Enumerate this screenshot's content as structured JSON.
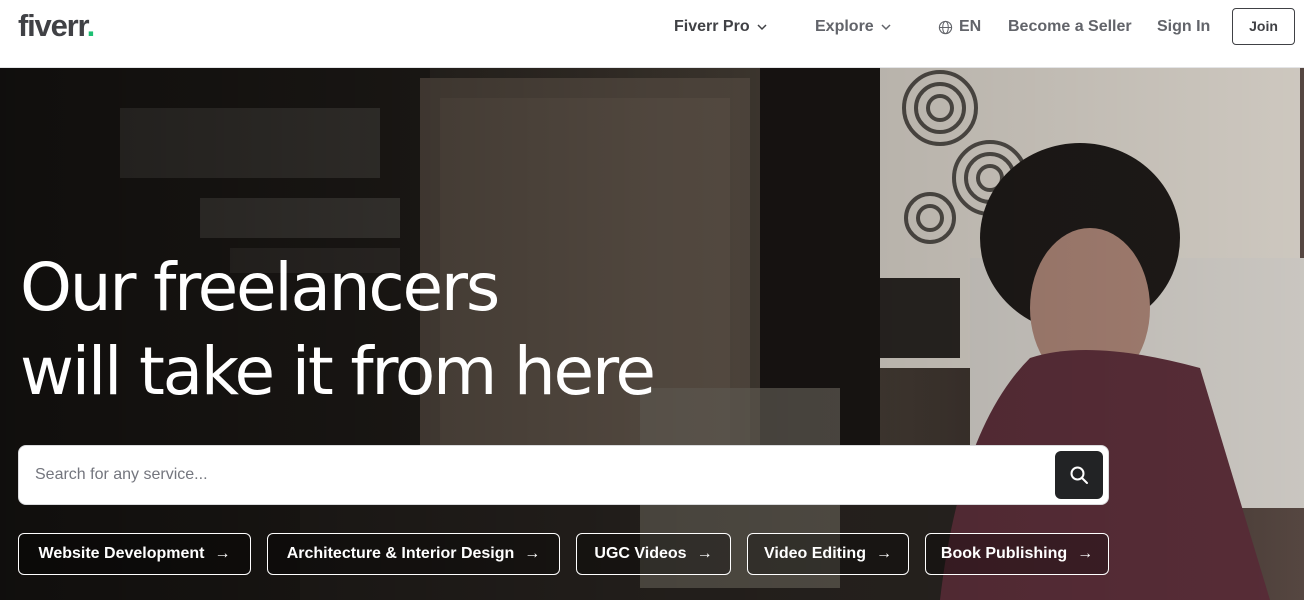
{
  "header": {
    "logo": "fiverr",
    "logo_dot": ".",
    "nav": {
      "fiverr_pro": "Fiverr Pro",
      "explore": "Explore",
      "language": "EN",
      "become_seller": "Become a Seller",
      "sign_in": "Sign In",
      "join": "Join"
    }
  },
  "hero": {
    "title_line1": "Our freelancers",
    "title_line2": "will take it from here",
    "search": {
      "placeholder": "Search for any service...",
      "value": ""
    },
    "chips": [
      {
        "label": "Website Development",
        "arrow": "→"
      },
      {
        "label": "Architecture & Interior Design",
        "arrow": "→"
      },
      {
        "label": "UGC Videos",
        "arrow": "→"
      },
      {
        "label": "Video Editing",
        "arrow": "→"
      },
      {
        "label": "Book Publishing",
        "arrow": "→"
      }
    ]
  },
  "colors": {
    "brand_green": "#1dbf73",
    "text_dark": "#404145",
    "search_button": "#222325"
  },
  "icons": [
    "chevron-down-icon",
    "globe-icon",
    "search-icon",
    "arrow-right-icon"
  ]
}
